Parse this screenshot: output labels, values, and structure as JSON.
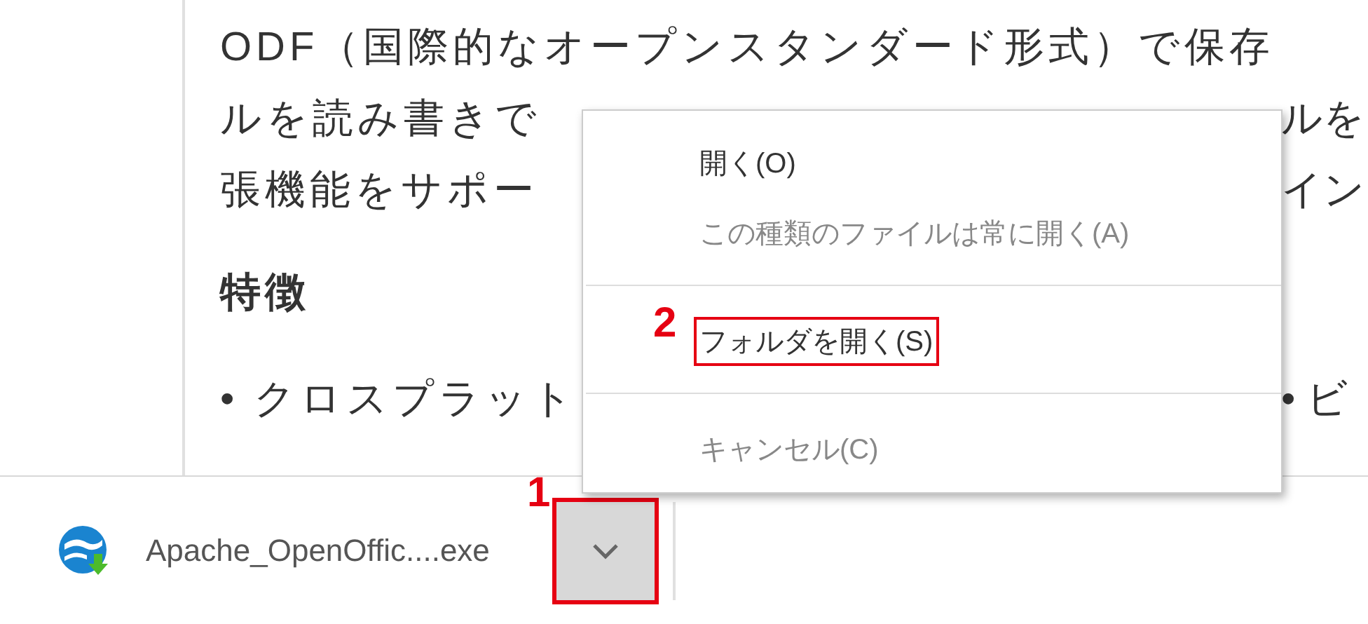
{
  "article": {
    "lines": [
      {
        "kind": "text",
        "left": "ODF（国際的なオープンスタンダード形式）で保存"
      },
      {
        "kind": "text",
        "left": "ルを読み書きで",
        "right": "ルを"
      },
      {
        "kind": "text",
        "left": "張機能をサポー",
        "right": "イン"
      },
      {
        "kind": "heading",
        "left": "特徴"
      },
      {
        "kind": "text",
        "left": "• クロスプラット",
        "right": "• ビ"
      }
    ]
  },
  "download_bar": {
    "filename": "Apache_OpenOffic....exe",
    "menu_button": {
      "annotation": "1",
      "pressed": true
    }
  },
  "context_menu": {
    "items": [
      {
        "label": "開く(O)",
        "disabled": false
      },
      {
        "label": "この種類のファイルは常に開く(A)",
        "disabled": true
      },
      {
        "kind": "separator"
      },
      {
        "label": "フォルダを開く(S)",
        "disabled": false,
        "annotation": "2"
      },
      {
        "kind": "separator"
      },
      {
        "label": "キャンセル(C)",
        "disabled": true
      }
    ]
  }
}
